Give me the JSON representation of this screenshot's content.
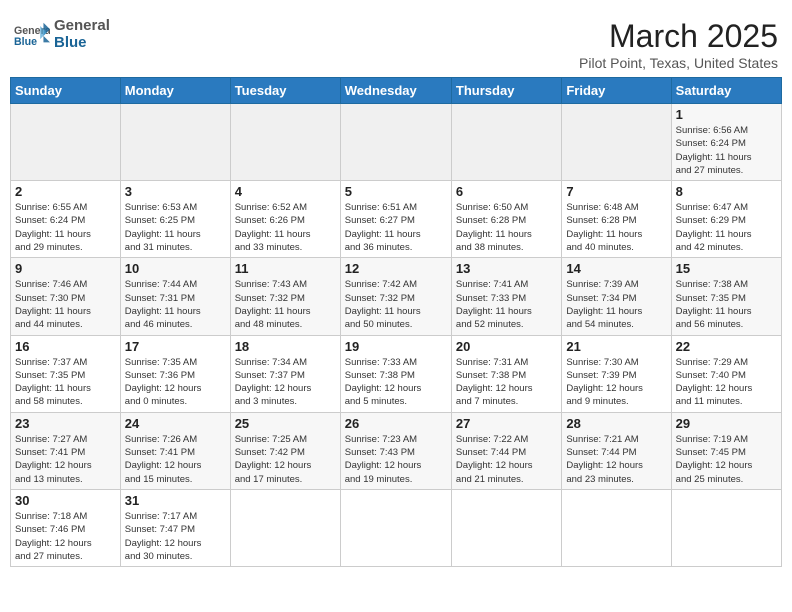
{
  "header": {
    "logo_general": "General",
    "logo_blue": "Blue",
    "month_title": "March 2025",
    "location": "Pilot Point, Texas, United States"
  },
  "days_of_week": [
    "Sunday",
    "Monday",
    "Tuesday",
    "Wednesday",
    "Thursday",
    "Friday",
    "Saturday"
  ],
  "weeks": [
    {
      "days": [
        {
          "num": "",
          "info": ""
        },
        {
          "num": "",
          "info": ""
        },
        {
          "num": "",
          "info": ""
        },
        {
          "num": "",
          "info": ""
        },
        {
          "num": "",
          "info": ""
        },
        {
          "num": "",
          "info": ""
        },
        {
          "num": "1",
          "info": "Sunrise: 6:56 AM\nSunset: 6:24 PM\nDaylight: 11 hours\nand 27 minutes."
        }
      ]
    },
    {
      "days": [
        {
          "num": "2",
          "info": "Sunrise: 6:55 AM\nSunset: 6:24 PM\nDaylight: 11 hours\nand 29 minutes."
        },
        {
          "num": "3",
          "info": "Sunrise: 6:53 AM\nSunset: 6:25 PM\nDaylight: 11 hours\nand 31 minutes."
        },
        {
          "num": "4",
          "info": "Sunrise: 6:52 AM\nSunset: 6:26 PM\nDaylight: 11 hours\nand 33 minutes."
        },
        {
          "num": "5",
          "info": "Sunrise: 6:51 AM\nSunset: 6:27 PM\nDaylight: 11 hours\nand 36 minutes."
        },
        {
          "num": "6",
          "info": "Sunrise: 6:50 AM\nSunset: 6:28 PM\nDaylight: 11 hours\nand 38 minutes."
        },
        {
          "num": "7",
          "info": "Sunrise: 6:48 AM\nSunset: 6:28 PM\nDaylight: 11 hours\nand 40 minutes."
        },
        {
          "num": "8",
          "info": "Sunrise: 6:47 AM\nSunset: 6:29 PM\nDaylight: 11 hours\nand 42 minutes."
        }
      ]
    },
    {
      "days": [
        {
          "num": "9",
          "info": "Sunrise: 7:46 AM\nSunset: 7:30 PM\nDaylight: 11 hours\nand 44 minutes."
        },
        {
          "num": "10",
          "info": "Sunrise: 7:44 AM\nSunset: 7:31 PM\nDaylight: 11 hours\nand 46 minutes."
        },
        {
          "num": "11",
          "info": "Sunrise: 7:43 AM\nSunset: 7:32 PM\nDaylight: 11 hours\nand 48 minutes."
        },
        {
          "num": "12",
          "info": "Sunrise: 7:42 AM\nSunset: 7:32 PM\nDaylight: 11 hours\nand 50 minutes."
        },
        {
          "num": "13",
          "info": "Sunrise: 7:41 AM\nSunset: 7:33 PM\nDaylight: 11 hours\nand 52 minutes."
        },
        {
          "num": "14",
          "info": "Sunrise: 7:39 AM\nSunset: 7:34 PM\nDaylight: 11 hours\nand 54 minutes."
        },
        {
          "num": "15",
          "info": "Sunrise: 7:38 AM\nSunset: 7:35 PM\nDaylight: 11 hours\nand 56 minutes."
        }
      ]
    },
    {
      "days": [
        {
          "num": "16",
          "info": "Sunrise: 7:37 AM\nSunset: 7:35 PM\nDaylight: 11 hours\nand 58 minutes."
        },
        {
          "num": "17",
          "info": "Sunrise: 7:35 AM\nSunset: 7:36 PM\nDaylight: 12 hours\nand 0 minutes."
        },
        {
          "num": "18",
          "info": "Sunrise: 7:34 AM\nSunset: 7:37 PM\nDaylight: 12 hours\nand 3 minutes."
        },
        {
          "num": "19",
          "info": "Sunrise: 7:33 AM\nSunset: 7:38 PM\nDaylight: 12 hours\nand 5 minutes."
        },
        {
          "num": "20",
          "info": "Sunrise: 7:31 AM\nSunset: 7:38 PM\nDaylight: 12 hours\nand 7 minutes."
        },
        {
          "num": "21",
          "info": "Sunrise: 7:30 AM\nSunset: 7:39 PM\nDaylight: 12 hours\nand 9 minutes."
        },
        {
          "num": "22",
          "info": "Sunrise: 7:29 AM\nSunset: 7:40 PM\nDaylight: 12 hours\nand 11 minutes."
        }
      ]
    },
    {
      "days": [
        {
          "num": "23",
          "info": "Sunrise: 7:27 AM\nSunset: 7:41 PM\nDaylight: 12 hours\nand 13 minutes."
        },
        {
          "num": "24",
          "info": "Sunrise: 7:26 AM\nSunset: 7:41 PM\nDaylight: 12 hours\nand 15 minutes."
        },
        {
          "num": "25",
          "info": "Sunrise: 7:25 AM\nSunset: 7:42 PM\nDaylight: 12 hours\nand 17 minutes."
        },
        {
          "num": "26",
          "info": "Sunrise: 7:23 AM\nSunset: 7:43 PM\nDaylight: 12 hours\nand 19 minutes."
        },
        {
          "num": "27",
          "info": "Sunrise: 7:22 AM\nSunset: 7:44 PM\nDaylight: 12 hours\nand 21 minutes."
        },
        {
          "num": "28",
          "info": "Sunrise: 7:21 AM\nSunset: 7:44 PM\nDaylight: 12 hours\nand 23 minutes."
        },
        {
          "num": "29",
          "info": "Sunrise: 7:19 AM\nSunset: 7:45 PM\nDaylight: 12 hours\nand 25 minutes."
        }
      ]
    },
    {
      "days": [
        {
          "num": "30",
          "info": "Sunrise: 7:18 AM\nSunset: 7:46 PM\nDaylight: 12 hours\nand 27 minutes."
        },
        {
          "num": "31",
          "info": "Sunrise: 7:17 AM\nSunset: 7:47 PM\nDaylight: 12 hours\nand 30 minutes."
        },
        {
          "num": "",
          "info": ""
        },
        {
          "num": "",
          "info": ""
        },
        {
          "num": "",
          "info": ""
        },
        {
          "num": "",
          "info": ""
        },
        {
          "num": "",
          "info": ""
        }
      ]
    }
  ]
}
